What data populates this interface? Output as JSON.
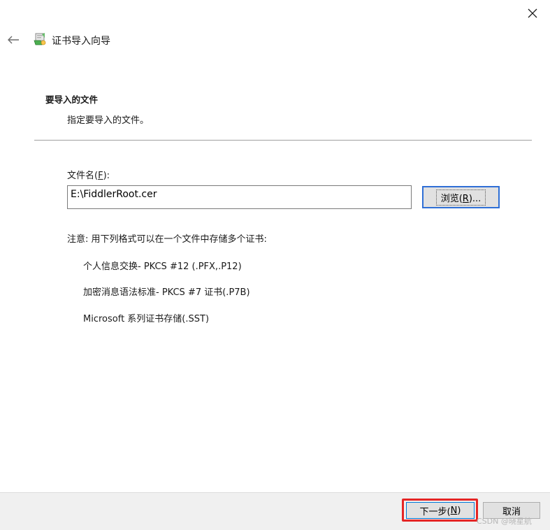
{
  "header": {
    "title": "证书导入向导"
  },
  "section": {
    "title": "要导入的文件",
    "description": "指定要导入的文件。"
  },
  "file": {
    "label_prefix": "文件名(",
    "label_hotkey": "F",
    "label_suffix": "):",
    "value": "E:\\FiddlerRoot.cer",
    "browse_prefix": "浏览(",
    "browse_hotkey": "R",
    "browse_suffix": ")..."
  },
  "note": {
    "text": "注意: 用下列格式可以在一个文件中存储多个证书:",
    "formats": [
      "个人信息交换- PKCS #12 (.PFX,.P12)",
      "加密消息语法标准- PKCS #7 证书(.P7B)",
      "Microsoft 系列证书存储(.SST)"
    ]
  },
  "footer": {
    "next_prefix": "下一步(",
    "next_hotkey": "N",
    "next_suffix": ")",
    "cancel_label": "取消"
  },
  "watermark": "CSDN @晓星航",
  "colors": {
    "highlight": "#e52525",
    "focus": "#2f6fd6",
    "footer_bg": "#f0f0f0"
  },
  "icons": {
    "close": "close-icon",
    "back": "back-arrow-icon",
    "wizard": "certificate-wizard-icon"
  }
}
